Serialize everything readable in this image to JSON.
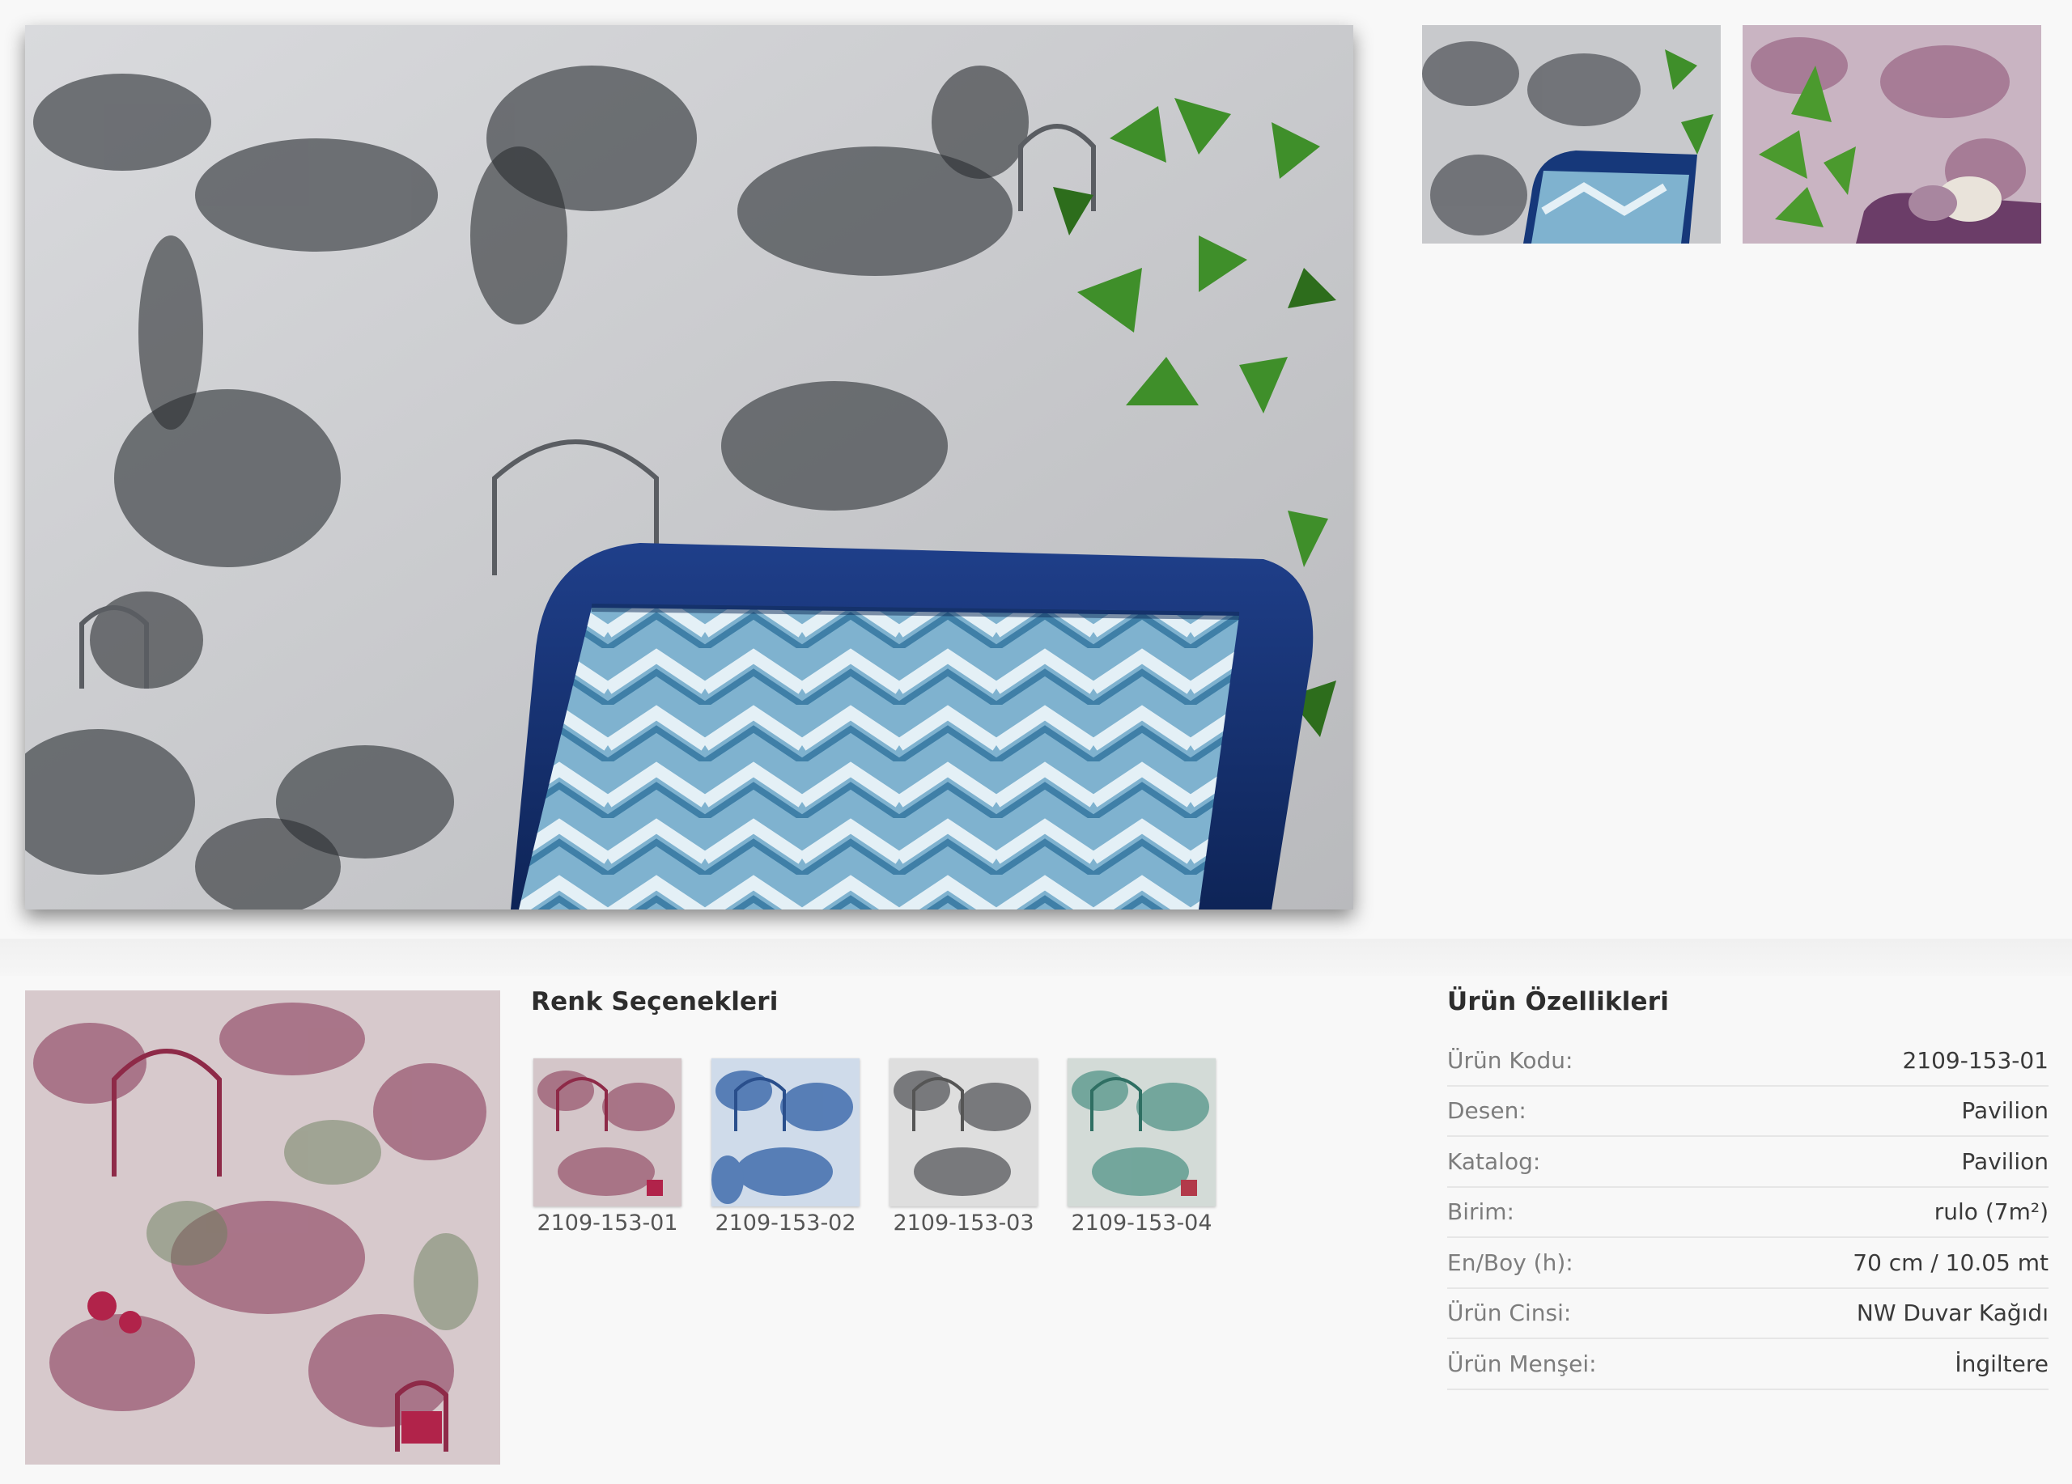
{
  "gallery": {
    "main_image": "pavilion-wallpaper-grey-with-blue-cushion",
    "thumbnails": [
      "pavilion-grey-cushion-thumbnail",
      "pavilion-plum-room-thumbnail"
    ]
  },
  "product_swatch": "pavilion-2109-153-01-swatch",
  "color_options": {
    "title": "Renk Seçenekleri",
    "items": [
      {
        "code": "2109-153-01",
        "tone": "#b78a9c"
      },
      {
        "code": "2109-153-02",
        "tone": "#4c77b3"
      },
      {
        "code": "2109-153-03",
        "tone": "#8a8a8a"
      },
      {
        "code": "2109-153-04",
        "tone": "#5f9a8c"
      }
    ]
  },
  "properties": {
    "title": "Ürün Özellikleri",
    "rows": [
      {
        "label": "Ürün Kodu:",
        "value": "2109-153-01"
      },
      {
        "label": "Desen:",
        "value": "Pavilion"
      },
      {
        "label": "Katalog:",
        "value": "Pavilion"
      },
      {
        "label": "Birim:",
        "value": "rulo (7m²)"
      },
      {
        "label": "En/Boy (h):",
        "value": "70 cm / 10.05 mt"
      },
      {
        "label": "Ürün Cinsi:",
        "value": "NW Duvar Kağıdı"
      },
      {
        "label": "Ürün Menşei:",
        "value": "İngiltere"
      }
    ]
  }
}
